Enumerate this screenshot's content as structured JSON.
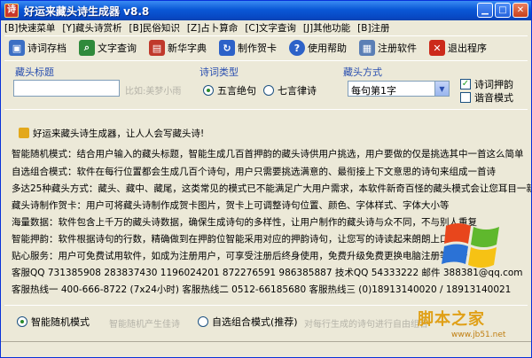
{
  "window": {
    "title": "好运来藏头诗生成器 v8.8"
  },
  "menu": [
    "[B]快速菜单",
    "[Y]藏头诗赏析",
    "[B]民俗知识",
    "[Z]占卜算命",
    "[C]文字查询",
    "[J]其他功能",
    "[B]注册"
  ],
  "toolbar": {
    "items": [
      {
        "label": "诗词存档",
        "icon": "disk-icon",
        "color": "#3b6fc4"
      },
      {
        "label": "文字查询",
        "icon": "search-icon",
        "color": "#2f8a3b"
      },
      {
        "label": "新华字典",
        "icon": "book-icon",
        "color": "#c0392b"
      },
      {
        "label": "制作贺卡",
        "icon": "card-icon",
        "color": "#2d62c8"
      },
      {
        "label": "使用帮助",
        "icon": "help-icon",
        "color": "#2d62c8"
      },
      {
        "label": "注册软件",
        "icon": "register-icon",
        "color": "#5b7fb5"
      },
      {
        "label": "退出程序",
        "icon": "exit-icon",
        "color": "#cc2a1a"
      }
    ]
  },
  "inputs": {
    "title_label": "藏头标题",
    "title_value": "",
    "title_hint": "比如:美梦小雨",
    "type_label": "诗词类型",
    "type_options": [
      "五言绝句",
      "七言律诗"
    ],
    "type_selected": 0,
    "mode_label": "藏头方式",
    "mode_value": "每句第1字",
    "checks": [
      {
        "label": "诗词押韵",
        "checked": true
      },
      {
        "label": "谐音模式",
        "checked": false
      }
    ]
  },
  "content": {
    "slogan": "好运来藏头诗生成器，让人人会写藏头诗!",
    "lines": [
      "智能随机模式：结合用户输入的藏头标题，智能生成几百首押韵的藏头诗供用户挑选，用户要做的仅是挑选其中一首这么简单",
      "自选组合模式：软件在每行位置都会生成几百个诗句，用户只需要挑选满意的、最衔接上下文意思的诗句来组成一首诗",
      "多达25种藏头方式：藏头、藏中、藏尾，这类常见的模式已不能满足广大用户需求，本软件新奇百怪的藏头模式会让您耳目一新",
      "藏头诗制作贺卡：用户可将藏头诗制作成贺卡图片，贺卡上可调整诗句位置、颜色、字体样式、字体大小等",
      "海量数据：软件包含上千万的藏头诗数据，确保生成诗句的多样性，让用户制作的藏头诗与众不同，不与别人重复",
      "智能押韵：软件根据诗句的行数，精确做到在押韵位智能采用对应的押韵诗句，让您写的诗读起来朗朗上口",
      "贴心服务：用户可免费试用软件，如成为注册用户，可享受注册后终身使用，免费升级免费更换电脑注册等服务",
      "客服QQ  731385908   283837430   1196024201   872276591   986385887   技术QQ 54333222   邮件 388381@qq.com",
      "客服热线一 400-666-8722 (7x24小时)   客服热线二 0512-66185680    客服热线三 (0)18913140020 / 18913140021"
    ]
  },
  "bottom": {
    "mode_options": [
      "智能随机模式",
      "自选组合模式(推荐)"
    ],
    "mode_selected": 0,
    "hint_random": "智能随机产生佳诗",
    "hint_combo": "对每行生成的诗句进行自由组合"
  },
  "watermark": {
    "text": "脚本之家",
    "sub": "www.jb51.net"
  }
}
